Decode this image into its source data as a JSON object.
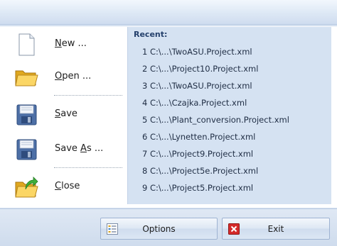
{
  "menu": {
    "items": [
      {
        "pre": "",
        "hot": "N",
        "post": "ew ...",
        "icon": "new-document-icon"
      },
      {
        "pre": "",
        "hot": "O",
        "post": "pen ...",
        "icon": "open-folder-icon"
      },
      {
        "pre": "",
        "hot": "S",
        "post": "ave",
        "icon": "save-disk-icon"
      },
      {
        "pre": "Save ",
        "hot": "A",
        "post": "s ...",
        "icon": "save-as-disk-icon"
      },
      {
        "pre": "",
        "hot": "C",
        "post": "lose",
        "icon": "close-folder-icon"
      }
    ]
  },
  "recent": {
    "title": "Recent:",
    "items": [
      "1 C:\\...\\TwoASU.Project.xml",
      "2 C:\\...\\Project10.Project.xml",
      "3 C:\\...\\TwoASU.Project.xml",
      "4 C:\\...\\Czajka.Project.xml",
      "5 C:\\...\\Plant_conversion.Project.xml",
      "6 C:\\...\\Lynetten.Project.xml",
      "7 C:\\...\\Project9.Project.xml",
      "8 C:\\...\\Project5e.Project.xml",
      "9 C:\\...\\Project5.Project.xml"
    ]
  },
  "footer": {
    "options_label": "Options",
    "exit_label": "Exit"
  },
  "colors": {
    "accent": "#d5e2f2",
    "exit_icon": "#d42a2a"
  }
}
